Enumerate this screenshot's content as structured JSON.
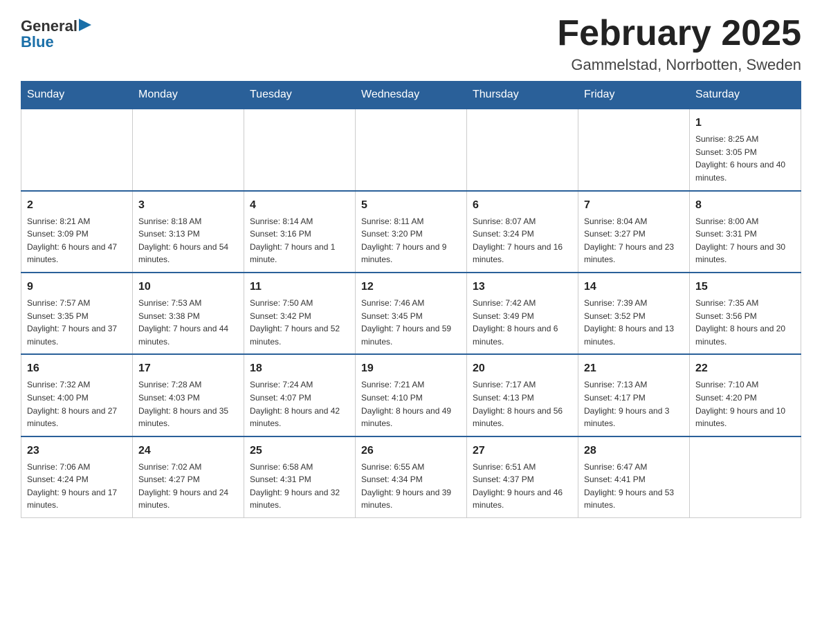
{
  "header": {
    "logo": {
      "general": "General",
      "arrow_symbol": "▶",
      "blue": "Blue"
    },
    "title": "February 2025",
    "location": "Gammelstad, Norrbotten, Sweden"
  },
  "weekdays": [
    "Sunday",
    "Monday",
    "Tuesday",
    "Wednesday",
    "Thursday",
    "Friday",
    "Saturday"
  ],
  "weeks": [
    [
      {
        "day": "",
        "info": ""
      },
      {
        "day": "",
        "info": ""
      },
      {
        "day": "",
        "info": ""
      },
      {
        "day": "",
        "info": ""
      },
      {
        "day": "",
        "info": ""
      },
      {
        "day": "",
        "info": ""
      },
      {
        "day": "1",
        "info": "Sunrise: 8:25 AM\nSunset: 3:05 PM\nDaylight: 6 hours and 40 minutes."
      }
    ],
    [
      {
        "day": "2",
        "info": "Sunrise: 8:21 AM\nSunset: 3:09 PM\nDaylight: 6 hours and 47 minutes."
      },
      {
        "day": "3",
        "info": "Sunrise: 8:18 AM\nSunset: 3:13 PM\nDaylight: 6 hours and 54 minutes."
      },
      {
        "day": "4",
        "info": "Sunrise: 8:14 AM\nSunset: 3:16 PM\nDaylight: 7 hours and 1 minute."
      },
      {
        "day": "5",
        "info": "Sunrise: 8:11 AM\nSunset: 3:20 PM\nDaylight: 7 hours and 9 minutes."
      },
      {
        "day": "6",
        "info": "Sunrise: 8:07 AM\nSunset: 3:24 PM\nDaylight: 7 hours and 16 minutes."
      },
      {
        "day": "7",
        "info": "Sunrise: 8:04 AM\nSunset: 3:27 PM\nDaylight: 7 hours and 23 minutes."
      },
      {
        "day": "8",
        "info": "Sunrise: 8:00 AM\nSunset: 3:31 PM\nDaylight: 7 hours and 30 minutes."
      }
    ],
    [
      {
        "day": "9",
        "info": "Sunrise: 7:57 AM\nSunset: 3:35 PM\nDaylight: 7 hours and 37 minutes."
      },
      {
        "day": "10",
        "info": "Sunrise: 7:53 AM\nSunset: 3:38 PM\nDaylight: 7 hours and 44 minutes."
      },
      {
        "day": "11",
        "info": "Sunrise: 7:50 AM\nSunset: 3:42 PM\nDaylight: 7 hours and 52 minutes."
      },
      {
        "day": "12",
        "info": "Sunrise: 7:46 AM\nSunset: 3:45 PM\nDaylight: 7 hours and 59 minutes."
      },
      {
        "day": "13",
        "info": "Sunrise: 7:42 AM\nSunset: 3:49 PM\nDaylight: 8 hours and 6 minutes."
      },
      {
        "day": "14",
        "info": "Sunrise: 7:39 AM\nSunset: 3:52 PM\nDaylight: 8 hours and 13 minutes."
      },
      {
        "day": "15",
        "info": "Sunrise: 7:35 AM\nSunset: 3:56 PM\nDaylight: 8 hours and 20 minutes."
      }
    ],
    [
      {
        "day": "16",
        "info": "Sunrise: 7:32 AM\nSunset: 4:00 PM\nDaylight: 8 hours and 27 minutes."
      },
      {
        "day": "17",
        "info": "Sunrise: 7:28 AM\nSunset: 4:03 PM\nDaylight: 8 hours and 35 minutes."
      },
      {
        "day": "18",
        "info": "Sunrise: 7:24 AM\nSunset: 4:07 PM\nDaylight: 8 hours and 42 minutes."
      },
      {
        "day": "19",
        "info": "Sunrise: 7:21 AM\nSunset: 4:10 PM\nDaylight: 8 hours and 49 minutes."
      },
      {
        "day": "20",
        "info": "Sunrise: 7:17 AM\nSunset: 4:13 PM\nDaylight: 8 hours and 56 minutes."
      },
      {
        "day": "21",
        "info": "Sunrise: 7:13 AM\nSunset: 4:17 PM\nDaylight: 9 hours and 3 minutes."
      },
      {
        "day": "22",
        "info": "Sunrise: 7:10 AM\nSunset: 4:20 PM\nDaylight: 9 hours and 10 minutes."
      }
    ],
    [
      {
        "day": "23",
        "info": "Sunrise: 7:06 AM\nSunset: 4:24 PM\nDaylight: 9 hours and 17 minutes."
      },
      {
        "day": "24",
        "info": "Sunrise: 7:02 AM\nSunset: 4:27 PM\nDaylight: 9 hours and 24 minutes."
      },
      {
        "day": "25",
        "info": "Sunrise: 6:58 AM\nSunset: 4:31 PM\nDaylight: 9 hours and 32 minutes."
      },
      {
        "day": "26",
        "info": "Sunrise: 6:55 AM\nSunset: 4:34 PM\nDaylight: 9 hours and 39 minutes."
      },
      {
        "day": "27",
        "info": "Sunrise: 6:51 AM\nSunset: 4:37 PM\nDaylight: 9 hours and 46 minutes."
      },
      {
        "day": "28",
        "info": "Sunrise: 6:47 AM\nSunset: 4:41 PM\nDaylight: 9 hours and 53 minutes."
      },
      {
        "day": "",
        "info": ""
      }
    ]
  ]
}
